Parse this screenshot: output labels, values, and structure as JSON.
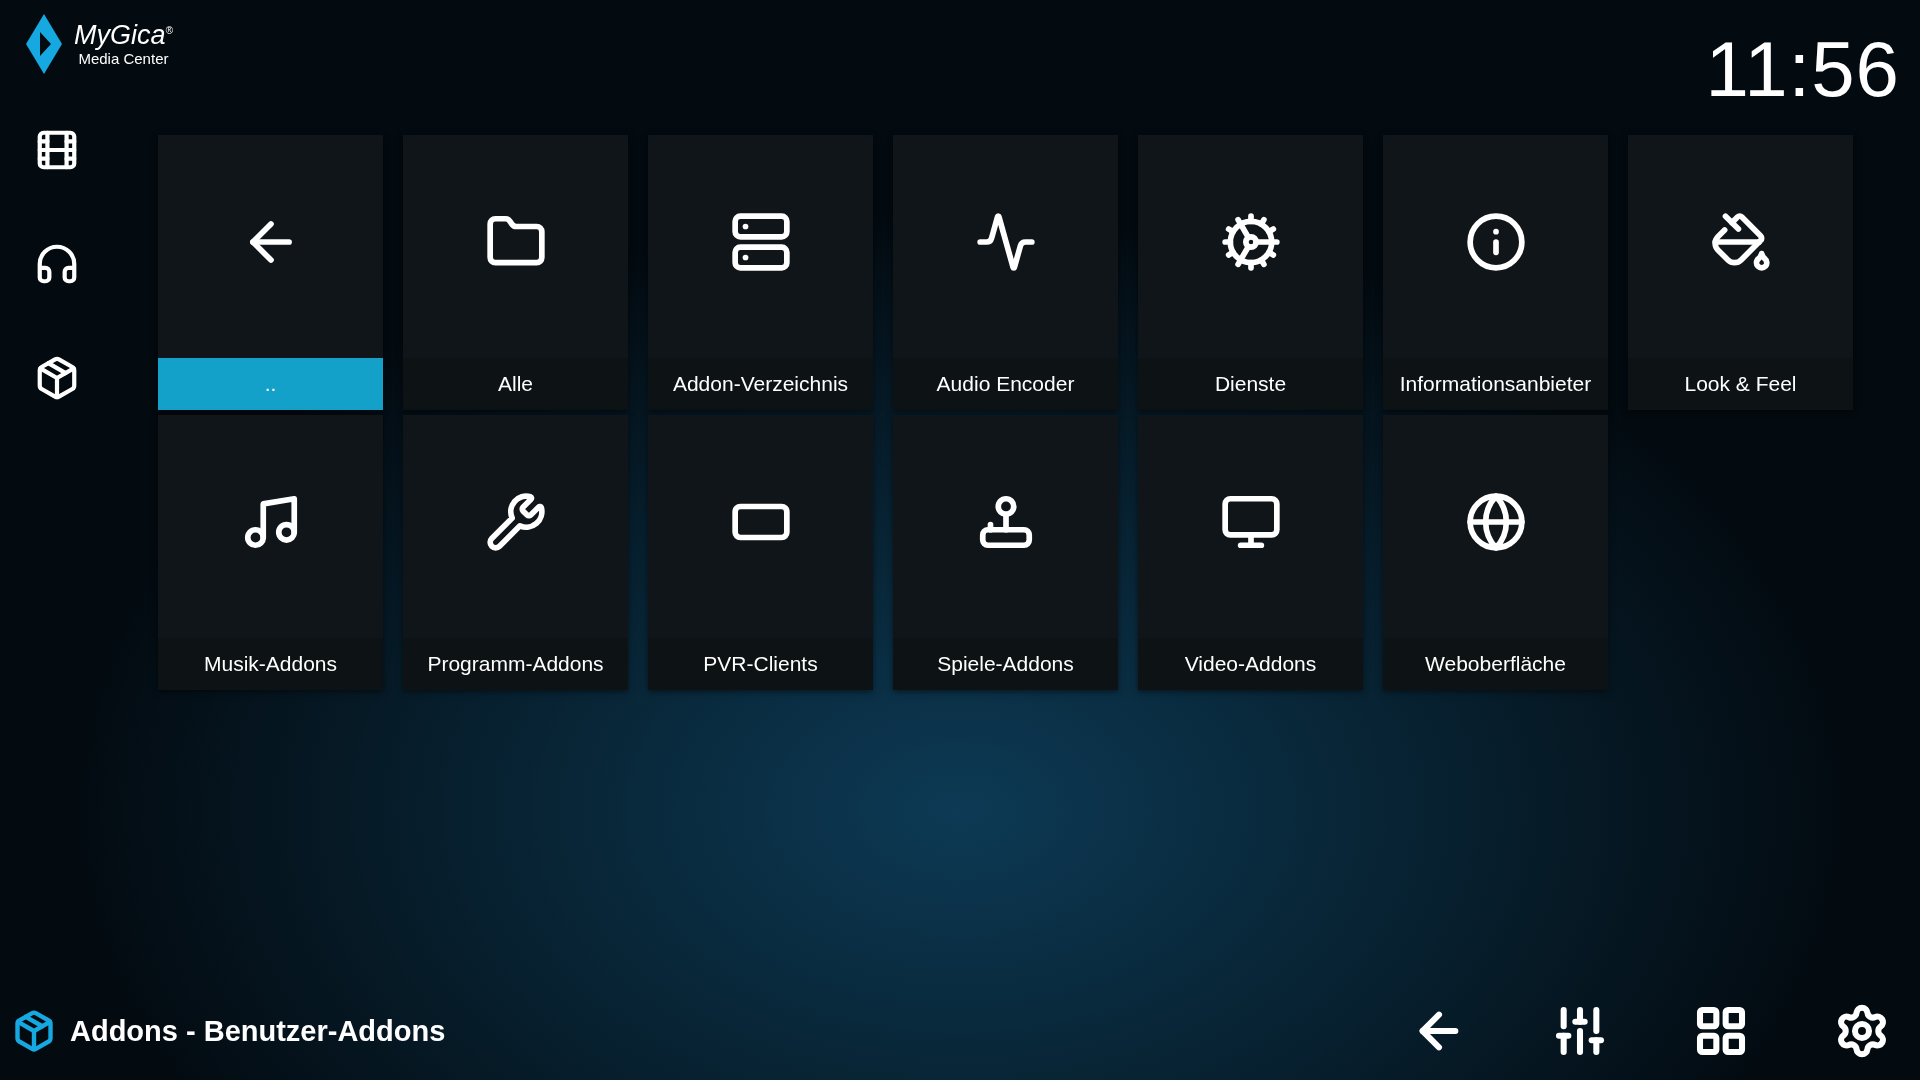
{
  "header": {
    "logo": {
      "brand": "MyGica$^{®}$",
      "subtitle": "Media Center"
    },
    "clock": "11:56"
  },
  "tiles": [
    {
      "label": "..",
      "selected": true
    },
    {
      "label": "Alle",
      "selected": false
    },
    {
      "label": "Addon-Verzeichnis",
      "selected": false
    },
    {
      "label": "Audio Encoder",
      "selected": false
    },
    {
      "label": "Dienste",
      "selected": false
    },
    {
      "label": "Informationsanbieter",
      "selected": false
    },
    {
      "label": "Look & Feel",
      "selected": false
    },
    {
      "label": "Musik-Addons",
      "selected": false
    },
    {
      "label": "Programm-Addons",
      "selected": false
    },
    {
      "label": "PVR-Clients",
      "selected": false
    },
    {
      "label": "Spiele-Addons",
      "selected": false
    },
    {
      "label": "Video-Addons",
      "selected": false
    },
    {
      "label": "Weboberfläche",
      "selected": false
    }
  ],
  "status_bar": {
    "title": "Addons - Benutzer-Addons"
  }
}
